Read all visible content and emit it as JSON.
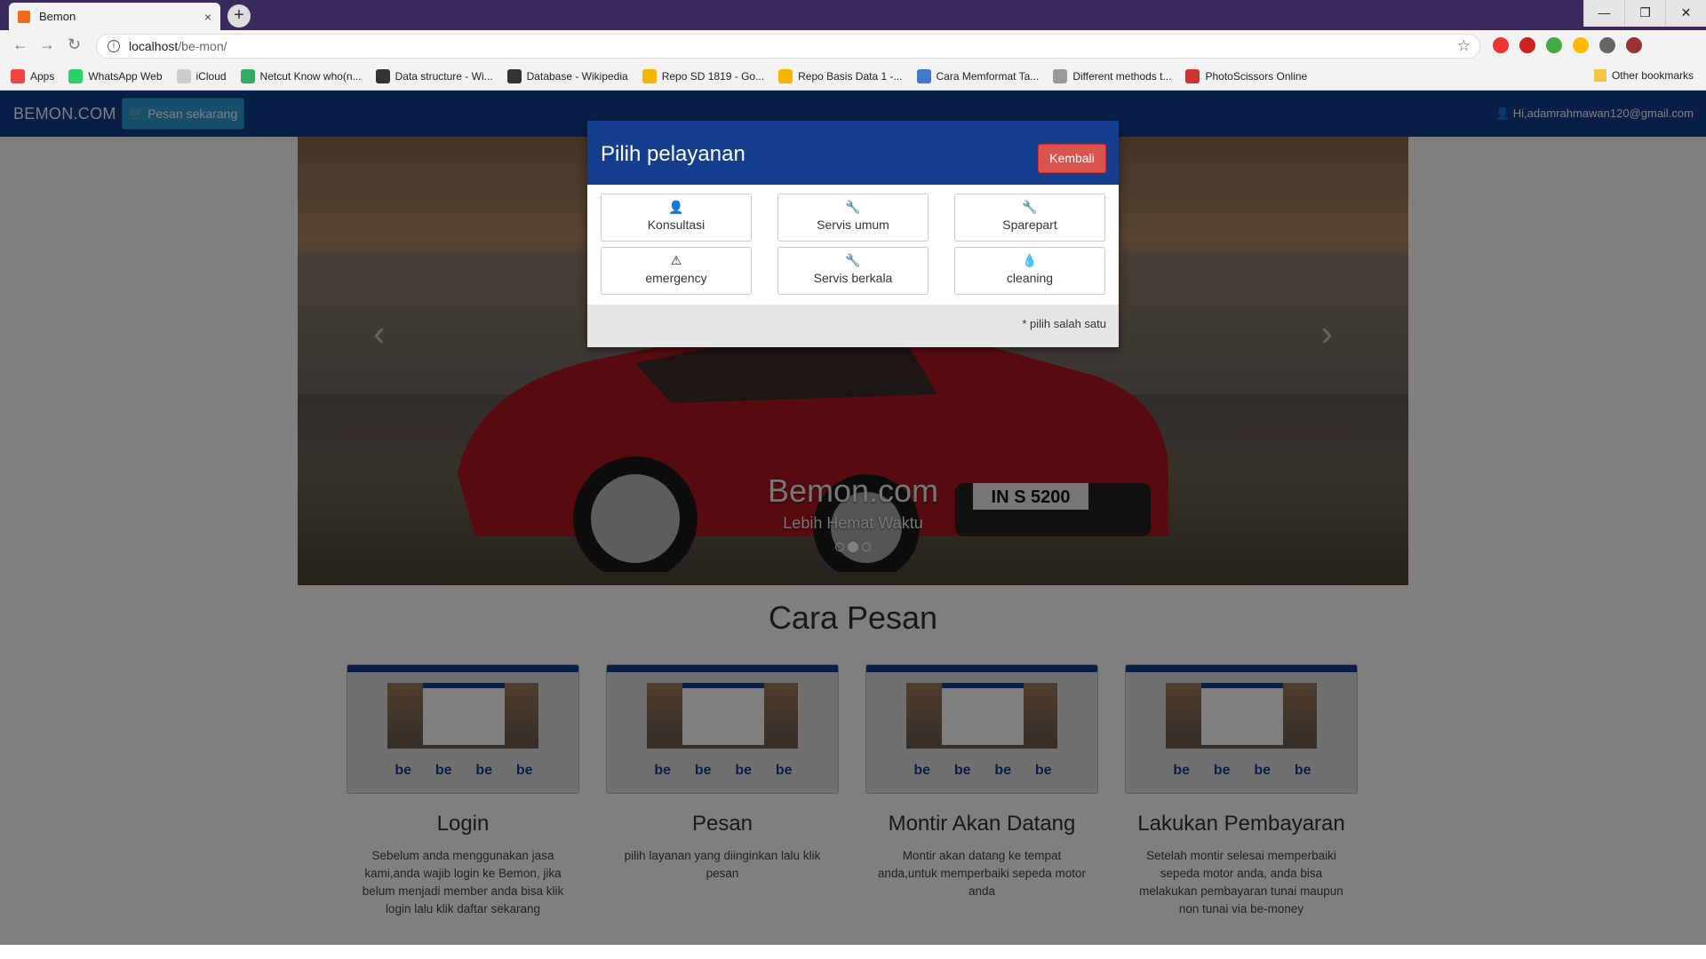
{
  "browser": {
    "tab_title": "Bemon",
    "tab_close": "×",
    "new_tab": "+",
    "url_host": "localhost",
    "url_path": "/be-mon/",
    "window_buttons": [
      "—",
      "❐",
      "✕"
    ],
    "bookmarks": [
      {
        "label": "Apps",
        "color": "#e44"
      },
      {
        "label": "WhatsApp Web",
        "color": "#25d366"
      },
      {
        "label": "iCloud",
        "color": "#ccc"
      },
      {
        "label": "Netcut Know who(n...",
        "color": "#3a6"
      },
      {
        "label": "Data structure - Wi...",
        "color": "#333"
      },
      {
        "label": "Database - Wikipedia",
        "color": "#333"
      },
      {
        "label": "Repo SD 1819 - Go...",
        "color": "#f4b400"
      },
      {
        "label": "Repo Basis Data 1 -...",
        "color": "#f4b400"
      },
      {
        "label": "Cara Memformat Ta...",
        "color": "#47c"
      },
      {
        "label": "Different methods t...",
        "color": "#999"
      },
      {
        "label": "PhotoScissors Online",
        "color": "#c33"
      }
    ],
    "other_bookmarks": "Other bookmarks"
  },
  "app": {
    "brand": "BEMON.COM",
    "order_button": "Pesan sekarang",
    "user": "Hi,adamrahmawan120@gmail.com"
  },
  "carousel": {
    "title": "Bemon.com",
    "subtitle": "Lebih Hemat Waktu",
    "plate": "IN S 5200",
    "active_slide": 2,
    "slides": 3
  },
  "how_to": {
    "title": "Cara Pesan",
    "thumb_logo": "be",
    "steps": [
      {
        "title": "Login",
        "text": "Sebelum anda menggunakan jasa kami,anda wajib login ke Bemon, jika belum menjadi member anda bisa klik login lalu klik daftar sekarang"
      },
      {
        "title": "Pesan",
        "text": "pilih layanan yang diinginkan lalu klik pesan"
      },
      {
        "title": "Montir Akan Datang",
        "text": "Montir akan datang ke tempat anda,untuk memperbaiki sepeda motor anda"
      },
      {
        "title": "Lakukan Pembayaran",
        "text": "Setelah montir selesai memperbaiki sepeda motor anda, anda bisa melakukan pembayaran tunai maupun non tunai via be-money"
      }
    ]
  },
  "modal": {
    "title": "Pilih pelayanan",
    "back": "Kembali",
    "options": [
      {
        "label": "Konsultasi",
        "icon": "user-icon"
      },
      {
        "label": "Servis umum",
        "icon": "wrench-icon"
      },
      {
        "label": "Sparepart",
        "icon": "wrench-icon"
      },
      {
        "label": "emergency",
        "icon": "warning-icon"
      },
      {
        "label": "Servis berkala",
        "icon": "wrench-icon"
      },
      {
        "label": "cleaning",
        "icon": "drop-icon"
      }
    ],
    "footer": "* pilih salah satu"
  },
  "colors": {
    "navbar": "#153e8f",
    "primary_button": "#2c9fd6",
    "danger": "#d9534f"
  }
}
